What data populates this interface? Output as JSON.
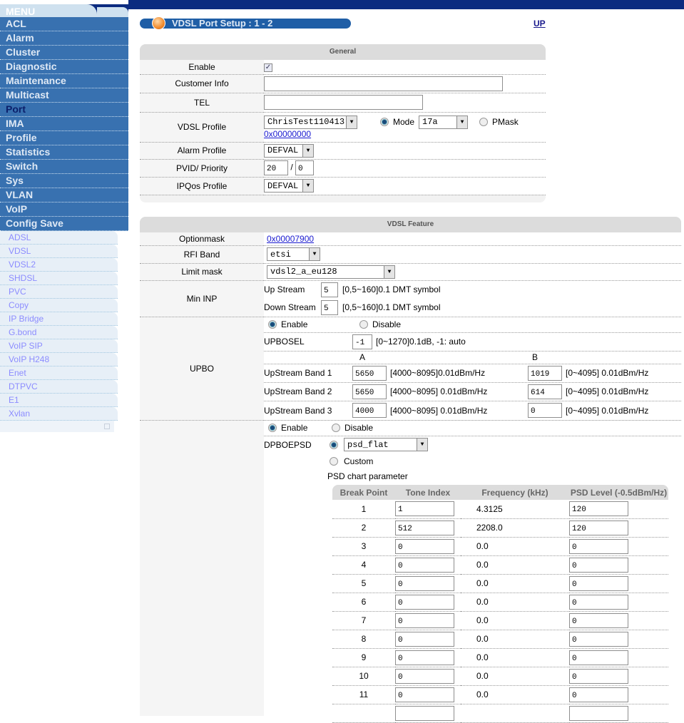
{
  "menu": {
    "title": "MENU",
    "items": [
      "ACL",
      "Alarm",
      "Cluster",
      "Diagnostic",
      "Maintenance",
      "Multicast",
      "Port",
      "IMA",
      "Profile",
      "Statistics",
      "Switch",
      "Sys",
      "VLAN",
      "VoIP",
      "Config Save"
    ],
    "active": "Port",
    "sub_items": [
      "ADSL",
      "VDSL",
      "VDSL2",
      "SHDSL",
      "PVC",
      "Copy",
      "IP Bridge",
      "G.bond",
      "VoIP SIP",
      "VoIP H248",
      "Enet",
      "DTPVC",
      "E1",
      "Xvlan"
    ]
  },
  "page": {
    "title": "VDSL Port Setup : 1 - 2",
    "up_link": "UP"
  },
  "general": {
    "header": "General",
    "enable_label": "Enable",
    "enable_checked": true,
    "customer_info_label": "Customer Info",
    "customer_info": "",
    "tel_label": "TEL",
    "tel": "",
    "vdsl_profile_label": "VDSL Profile",
    "vdsl_profile": "ChrisTest110413",
    "mode_label": "Mode",
    "mode": "17a",
    "pmask_label": "PMask",
    "profile_link": "0x00000000",
    "alarm_profile_label": "Alarm Profile",
    "alarm_profile": "DEFVAL",
    "pvid_label": "PVID/ Priority",
    "pvid": "20",
    "sep": "/",
    "priority": "0",
    "ipqos_label": "IPQos Profile",
    "ipqos_profile": "DEFVAL"
  },
  "feature": {
    "header": "VDSL Feature",
    "optionmask_label": "Optionmask",
    "optionmask": "0x00007900",
    "rfi_label": "RFI Band",
    "rfi": "etsi",
    "limit_label": "Limit mask",
    "limit": "vdsl2_a_eu128",
    "mininp_label": "Min INP",
    "up_label": "Up Stream",
    "up": "5",
    "down_label": "Down Stream",
    "down": "5",
    "inp_range": "[0,5~160]0.1 DMT symbol",
    "upbo_label": "UPBO",
    "enable": "Enable",
    "disable": "Disable",
    "upbosel_label": "UPBOSEL",
    "upbosel": "-1",
    "upbosel_range": "[0~1270]0.1dB, -1: auto",
    "col_a": "A",
    "col_b": "B",
    "bands": [
      {
        "label": "UpStream Band 1",
        "a": "5650",
        "a_range": "[4000~8095]0.01dBm/Hz",
        "b": "1019",
        "b_range": "[0~4095] 0.01dBm/Hz"
      },
      {
        "label": "UpStream Band 2",
        "a": "5650",
        "a_range": "[4000~8095] 0.01dBm/Hz",
        "b": "614",
        "b_range": "[0~4095] 0.01dBm/Hz"
      },
      {
        "label": "UpStream Band 3",
        "a": "4000",
        "a_range": "[4000~8095] 0.01dBm/Hz",
        "b": "0",
        "b_range": "[0~4095] 0.01dBm/Hz"
      }
    ],
    "dpbo_enable": "Enable",
    "dpbo_disable": "Disable",
    "dpboepsd_label": "DPBOEPSD",
    "dpboepsd": "psd_flat",
    "custom": "Custom",
    "psd_title": "PSD chart parameter",
    "psd_headers": [
      "Break Point",
      "Tone Index",
      "Frequency (kHz)",
      "PSD Level (-0.5dBm/Hz)"
    ],
    "psd_rows": [
      [
        "1",
        "1",
        "4.3125",
        "120"
      ],
      [
        "2",
        "512",
        "2208.0",
        "120"
      ],
      [
        "3",
        "0",
        "0.0",
        "0"
      ],
      [
        "4",
        "0",
        "0.0",
        "0"
      ],
      [
        "5",
        "0",
        "0.0",
        "0"
      ],
      [
        "6",
        "0",
        "0.0",
        "0"
      ],
      [
        "7",
        "0",
        "0.0",
        "0"
      ],
      [
        "8",
        "0",
        "0.0",
        "0"
      ],
      [
        "9",
        "0",
        "0.0",
        "0"
      ],
      [
        "10",
        "0",
        "0.0",
        "0"
      ],
      [
        "11",
        "0",
        "0.0",
        "0"
      ],
      [
        "",
        "",
        "",
        ""
      ]
    ]
  }
}
